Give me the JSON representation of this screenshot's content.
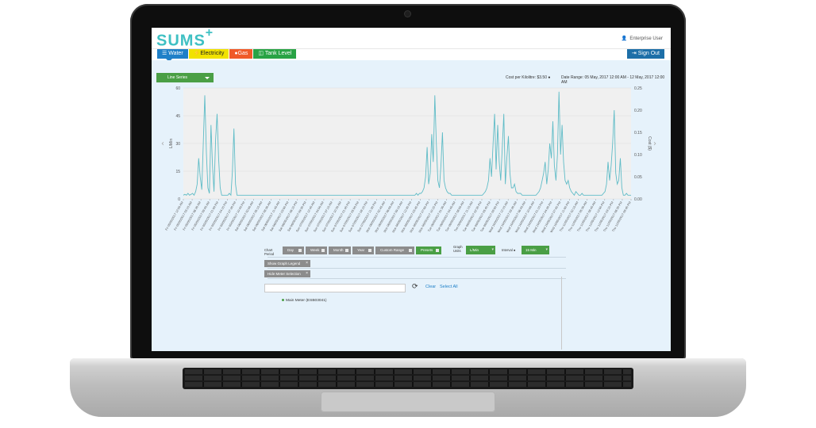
{
  "app": {
    "logo": "SUMS",
    "logo_plus": "+",
    "user": "Enterprise User",
    "sign_out": "Sign Out"
  },
  "tabs": [
    {
      "label": "Water",
      "icon": "water-icon"
    },
    {
      "label": "Electricity",
      "icon": "bolt-icon"
    },
    {
      "label": "Gas",
      "icon": "flame-icon"
    },
    {
      "label": "Tank Level",
      "icon": "tank-icon"
    }
  ],
  "info": {
    "series_select": "Line Series",
    "cost": "Cost per Kilolitre: $3.50",
    "range": "Date Range: 05 May, 2017 12:00 AM - 12 May, 2017 12:00 AM"
  },
  "controls": {
    "chart_period_label": "Chart Period",
    "period_buttons": [
      "Day",
      "Week",
      "Month",
      "Year",
      "Custom Range",
      "Presets"
    ],
    "graph_units_label": "Graph Units",
    "units_value": "L/Min",
    "interval_label": "Interval",
    "interval_value": "15 Min",
    "show_legend": "Show Graph Legend",
    "hide_meter": "Hide Meter Selection",
    "clear": "Clear",
    "select_all": "Select All",
    "meter_name": "Main Meter (ESB03041)"
  },
  "colors": {
    "brand": "#3fc0c3",
    "water": "#1f80c8",
    "electricity": "#f1e200",
    "gas": "#f05a28",
    "tank": "#29a345",
    "line": "#5fbcc7"
  },
  "chart_data": {
    "type": "line",
    "ylabel": "L/Min",
    "y2label": "Cost ($)",
    "ylim": [
      0,
      60
    ],
    "y2lim": [
      0,
      0.25
    ],
    "yticks": [
      "0",
      "15",
      "30",
      "45",
      "60"
    ],
    "y2ticks": [
      "0.00",
      "0.05",
      "0.10",
      "0.15",
      "0.20",
      "0.25"
    ],
    "xticks": [
      "Fri 05/05/2017 12:00 AM",
      "Fri 05/05/2017 03:15 AM",
      "Fri 05/05/2017 06:30 AM",
      "Fri 05/05/2017 09:45 AM",
      "Fri 05/05/2017 01:00 PM",
      "Fri 05/05/2017 04:15 PM",
      "Fri 05/05/2017 07:30 PM",
      "Fri 05/05/2017 10:45 PM",
      "Sat 06/05/2017 02:00 AM",
      "Sat 06/05/2017 05:15 AM",
      "Sat 06/05/2017 08:30 AM",
      "Sat 06/05/2017 11:45 AM",
      "Sat 06/05/2017 03:00 PM",
      "Sat 06/05/2017 06:15 PM",
      "Sat 06/05/2017 09:30 PM",
      "Sun 07/05/2017 12:45 AM",
      "Sun 07/05/2017 04:00 AM",
      "Sun 07/05/2017 07:15 AM",
      "Sun 07/05/2017 10:30 AM",
      "Sun 07/05/2017 01:45 PM",
      "Sun 07/05/2017 05:00 PM",
      "Sun 07/05/2017 08:15 PM",
      "Sun 07/05/2017 11:30 PM",
      "Mon 08/05/2017 02:45 AM",
      "Mon 08/05/2017 06:00 AM",
      "Mon 08/05/2017 09:15 AM",
      "Mon 08/05/2017 12:30 PM",
      "Mon 08/05/2017 03:45 PM",
      "Mon 08/05/2017 07:00 PM",
      "Mon 08/05/2017 10:15 PM",
      "Tue 09/05/2017 01:30 AM",
      "Tue 09/05/2017 04:45 AM",
      "Tue 09/05/2017 08:00 AM",
      "Tue 09/05/2017 11:15 AM",
      "Tue 09/05/2017 02:30 PM",
      "Tue 09/05/2017 05:45 PM",
      "Tue 09/05/2017 09:00 PM",
      "Wed 10/05/2017 12:15 AM",
      "Wed 10/05/2017 03:30 AM",
      "Wed 10/05/2017 06:45 AM",
      "Wed 10/05/2017 10:00 AM",
      "Wed 10/05/2017 01:15 PM",
      "Wed 10/05/2017 04:30 PM",
      "Wed 10/05/2017 07:45 PM",
      "Wed 10/05/2017 11:00 PM",
      "Thu 11/05/2017 02:15 AM",
      "Thu 11/05/2017 05:30 AM",
      "Thu 11/05/2017 08:45 AM",
      "Thu 11/05/2017 12:00 PM",
      "Thu 11/05/2017 03:15 PM",
      "Thu 11/05/2017 06:30 PM",
      "Thu 11/05/2017 09:45 PM"
    ],
    "series": [
      {
        "values": [
          2,
          2.5,
          2,
          3,
          2,
          2.5,
          3,
          2,
          4,
          8,
          22,
          12,
          5,
          30,
          56,
          25,
          6,
          3,
          40,
          18,
          4,
          32,
          46,
          22,
          6,
          2,
          2,
          2,
          2,
          2,
          3,
          2,
          15,
          38,
          8,
          2,
          2,
          2,
          2,
          2,
          2,
          2,
          2,
          2,
          2,
          2,
          2,
          2,
          2,
          2,
          2,
          2,
          2,
          2,
          2,
          2,
          2,
          2,
          2,
          2,
          2,
          2,
          2,
          2,
          2,
          2,
          2,
          2,
          2,
          2,
          2,
          2,
          2,
          2,
          2,
          2,
          2,
          2,
          2,
          2,
          2,
          2,
          2,
          2,
          2,
          2,
          2,
          2,
          2,
          2,
          2,
          2,
          2,
          2,
          2,
          2,
          2,
          2,
          2,
          2,
          2,
          2,
          2,
          2,
          2,
          2,
          2,
          2,
          2,
          2,
          2,
          2,
          2,
          2,
          2,
          2,
          2,
          2,
          2,
          2,
          2,
          2,
          2,
          2,
          2,
          2,
          2,
          2,
          2,
          2,
          2,
          2,
          2,
          2,
          2,
          2,
          2,
          2,
          2,
          2,
          2,
          2,
          2,
          2,
          2,
          2,
          2,
          2,
          2,
          2,
          2,
          2,
          3,
          2,
          3,
          3,
          4,
          6,
          12,
          28,
          8,
          14,
          35,
          20,
          56,
          30,
          10,
          6,
          18,
          36,
          10,
          6,
          4,
          3,
          3,
          2,
          2,
          2,
          2,
          2,
          2,
          2,
          2,
          2,
          2,
          2,
          2,
          2,
          2,
          2,
          2,
          2,
          2,
          2,
          2,
          2,
          3,
          4,
          6,
          10,
          22,
          12,
          30,
          46,
          16,
          40,
          20,
          10,
          28,
          46,
          8,
          22,
          34,
          14,
          6,
          6,
          8,
          4,
          3,
          3,
          3,
          2,
          2,
          2,
          2,
          2,
          2,
          2,
          2,
          2,
          2,
          3,
          4,
          6,
          10,
          14,
          20,
          8,
          16,
          30,
          22,
          42,
          18,
          10,
          24,
          58,
          24,
          40,
          20,
          10,
          8,
          10,
          6,
          4,
          3,
          2,
          4,
          3,
          2,
          2,
          3,
          2,
          2,
          2,
          2,
          2,
          2,
          2,
          2,
          2,
          2,
          2,
          2,
          2,
          3,
          4,
          8,
          20,
          10,
          18,
          30,
          48,
          14,
          8,
          10,
          22,
          6,
          2,
          2,
          3,
          2,
          2,
          2
        ]
      }
    ]
  }
}
